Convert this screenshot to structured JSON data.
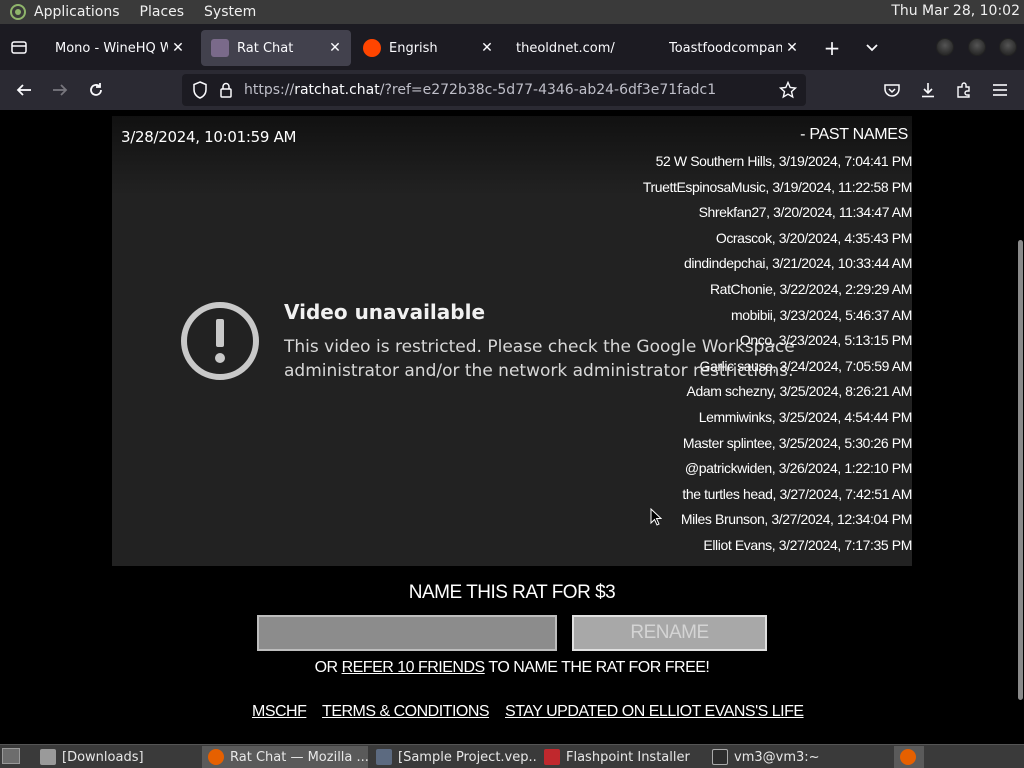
{
  "top_panel": {
    "menus": [
      "Applications",
      "Places",
      "System"
    ],
    "clock": "Thu Mar 28, 10:02"
  },
  "tabs": [
    {
      "title": "Mono - WineHQ Wiki",
      "active": false
    },
    {
      "title": "Rat Chat",
      "active": true
    },
    {
      "title": "Engrish",
      "active": false
    },
    {
      "title": "theoldnet.com/",
      "active": false
    },
    {
      "title": "Toastfoodcompany",
      "active": false
    }
  ],
  "url": {
    "scheme": "https://",
    "host": "ratchat.chat",
    "rest": "/?ref=e272b38c-5d77-4346-ab24-6df3e71fadc1"
  },
  "page": {
    "timestamp": "3/28/2024, 10:01:59 AM",
    "video": {
      "title": "Video unavailable",
      "message": "This video is restricted. Please check the Google Workspace administrator and/or the network administrator restrictions."
    },
    "past_names_header": "- PAST NAMES",
    "past_names": [
      "52 W Southern Hills, 3/19/2024, 7:04:41 PM",
      "TruettEspinosaMusic, 3/19/2024, 11:22:58 PM",
      "Shrekfan27, 3/20/2024, 11:34:47 AM",
      "Ocrascok, 3/20/2024, 4:35:43 PM",
      "dindindepchai, 3/21/2024, 10:33:44 AM",
      "RatChonie, 3/22/2024, 2:29:29 AM",
      "mobibii, 3/23/2024, 5:46:37 AM",
      "Onco, 3/23/2024, 5:13:15 PM",
      "Garlic sause, 3/24/2024, 7:05:59 AM",
      "Adam schezny, 3/25/2024, 8:26:21 AM",
      "Lemmiwinks, 3/25/2024, 4:54:44 PM",
      "Master splintee, 3/25/2024, 5:30:26 PM",
      "@patrickwiden, 3/26/2024, 1:22:10 PM",
      "the turtles head, 3/27/2024, 7:42:51 AM",
      "Miles Brunson, 3/27/2024, 12:34:04 PM",
      "Elliot Evans, 3/27/2024, 7:17:35 PM"
    ],
    "rename_title": "NAME THIS RAT FOR $3",
    "rename_input_value": "",
    "rename_button": "RENAME",
    "refer_prefix": "OR ",
    "refer_link": "REFER 10 FRIENDS",
    "refer_suffix": " TO NAME THE RAT FOR FREE!",
    "footer_links": [
      "MSCHF",
      "TERMS & CONDITIONS",
      "STAY UPDATED ON ELLIOT EVANS'S LIFE"
    ]
  },
  "taskbar": [
    {
      "label": "[Downloads]",
      "icon": "folder-icon",
      "active": false
    },
    {
      "label": "Rat Chat — Mozilla ...",
      "icon": "firefox-icon",
      "active": true
    },
    {
      "label": "[Sample Project.vep...",
      "icon": "editor-icon",
      "active": false
    },
    {
      "label": "Flashpoint Installer",
      "icon": "flashpoint-icon",
      "active": false
    },
    {
      "label": "vm3@vm3:~",
      "icon": "terminal-icon",
      "active": false
    }
  ],
  "colors": {
    "panel": "#3a3a3a",
    "tabstrip": "#1c1b22",
    "navbar": "#2b2a33",
    "video_bg": "#222222",
    "button_bg": "#a8a8a8"
  }
}
